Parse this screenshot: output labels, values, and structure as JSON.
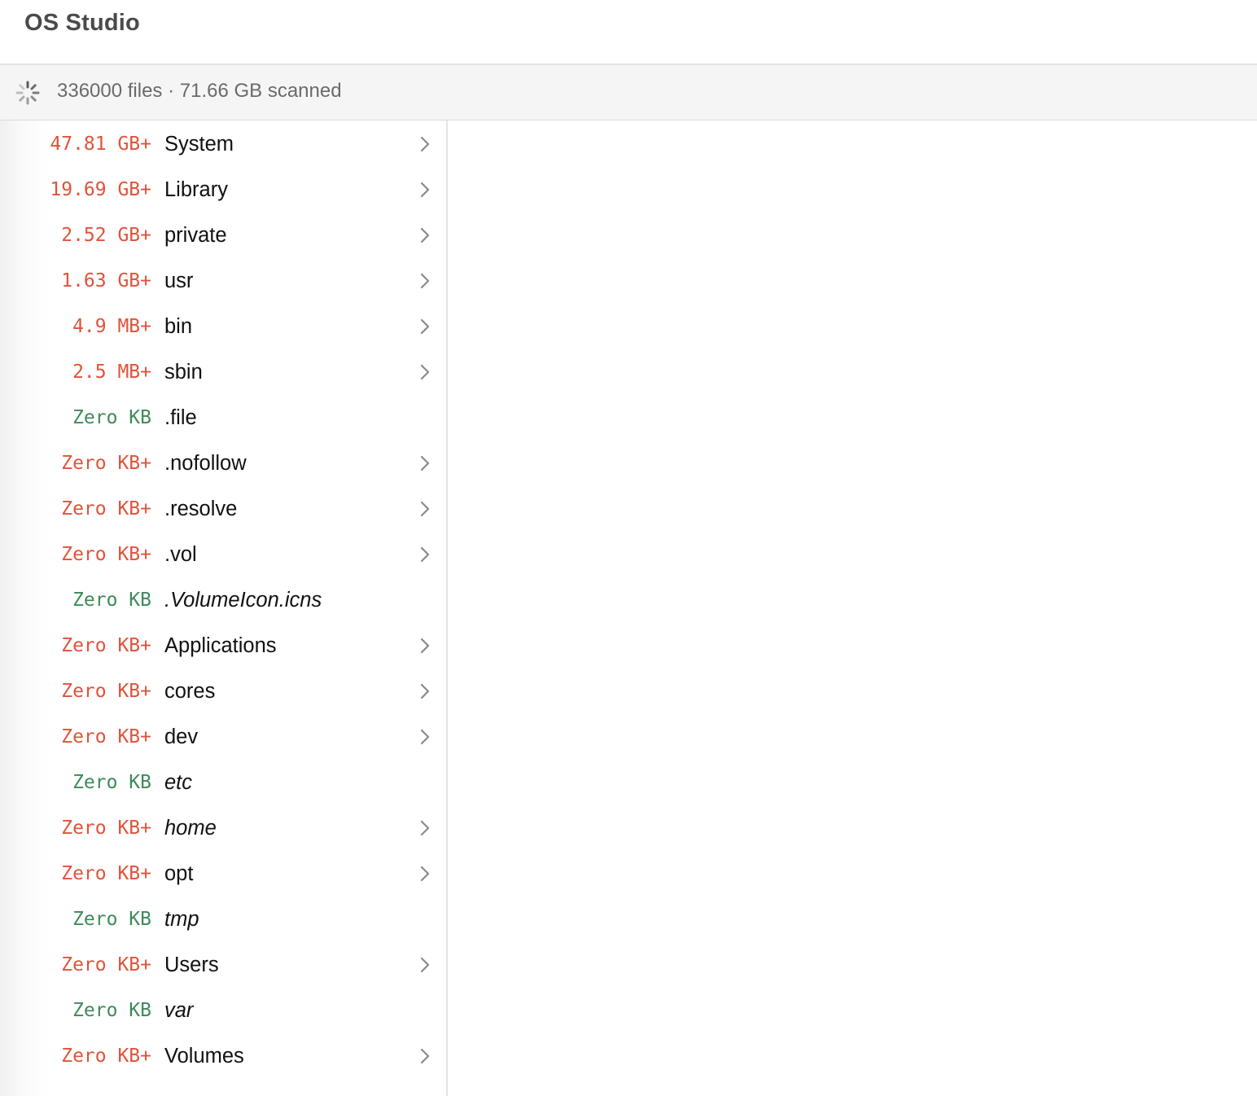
{
  "app": {
    "title": "OS Studio"
  },
  "status": {
    "text": "336000 files · 71.66 GB scanned",
    "icon": "loading-spinner-icon"
  },
  "colors": {
    "partial_size": "#e0533a",
    "complete_size": "#3e8a58",
    "chevron": "#8a8a8a"
  },
  "entries": [
    {
      "size": "47.81 GB+",
      "name": "System",
      "partial": true,
      "italic": false,
      "expandable": true
    },
    {
      "size": "19.69 GB+",
      "name": "Library",
      "partial": true,
      "italic": false,
      "expandable": true
    },
    {
      "size": "2.52 GB+",
      "name": "private",
      "partial": true,
      "italic": false,
      "expandable": true
    },
    {
      "size": "1.63 GB+",
      "name": "usr",
      "partial": true,
      "italic": false,
      "expandable": true
    },
    {
      "size": "4.9 MB+",
      "name": "bin",
      "partial": true,
      "italic": false,
      "expandable": true
    },
    {
      "size": "2.5 MB+",
      "name": "sbin",
      "partial": true,
      "italic": false,
      "expandable": true
    },
    {
      "size": "Zero KB",
      "name": ".file",
      "partial": false,
      "italic": false,
      "expandable": false
    },
    {
      "size": "Zero KB+",
      "name": ".nofollow",
      "partial": true,
      "italic": false,
      "expandable": true
    },
    {
      "size": "Zero KB+",
      "name": ".resolve",
      "partial": true,
      "italic": false,
      "expandable": true
    },
    {
      "size": "Zero KB+",
      "name": ".vol",
      "partial": true,
      "italic": false,
      "expandable": true
    },
    {
      "size": "Zero KB",
      "name": ".VolumeIcon.icns",
      "partial": false,
      "italic": true,
      "expandable": false
    },
    {
      "size": "Zero KB+",
      "name": "Applications",
      "partial": true,
      "italic": false,
      "expandable": true
    },
    {
      "size": "Zero KB+",
      "name": "cores",
      "partial": true,
      "italic": false,
      "expandable": true
    },
    {
      "size": "Zero KB+",
      "name": "dev",
      "partial": true,
      "italic": false,
      "expandable": true
    },
    {
      "size": "Zero KB",
      "name": "etc",
      "partial": false,
      "italic": true,
      "expandable": false
    },
    {
      "size": "Zero KB+",
      "name": "home",
      "partial": true,
      "italic": true,
      "expandable": true
    },
    {
      "size": "Zero KB+",
      "name": "opt",
      "partial": true,
      "italic": false,
      "expandable": true
    },
    {
      "size": "Zero KB",
      "name": "tmp",
      "partial": false,
      "italic": true,
      "expandable": false
    },
    {
      "size": "Zero KB+",
      "name": "Users",
      "partial": true,
      "italic": false,
      "expandable": true
    },
    {
      "size": "Zero KB",
      "name": "var",
      "partial": false,
      "italic": true,
      "expandable": false
    },
    {
      "size": "Zero KB+",
      "name": "Volumes",
      "partial": true,
      "italic": false,
      "expandable": true
    }
  ]
}
